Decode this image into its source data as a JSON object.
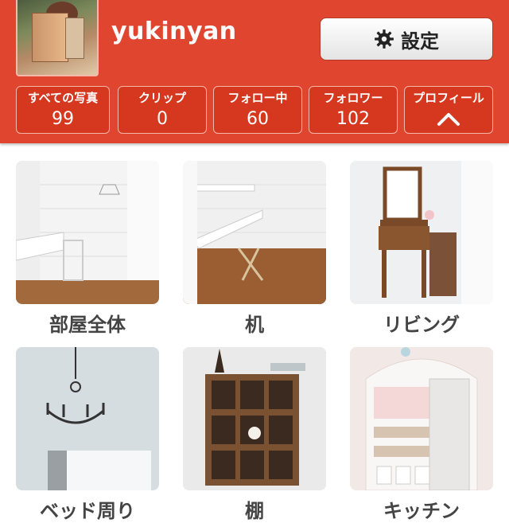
{
  "profile": {
    "username": "yukinyan",
    "avatar_icon": "profile-photo"
  },
  "settings": {
    "label": "設定",
    "icon": "gear-icon"
  },
  "stats": [
    {
      "label": "すべての写真",
      "value": "99"
    },
    {
      "label": "クリップ",
      "value": "0"
    },
    {
      "label": "フォロー中",
      "value": "60"
    },
    {
      "label": "フォロワー",
      "value": "102"
    },
    {
      "label": "プロフィール",
      "icon": "chevron-up-icon"
    }
  ],
  "categories": [
    {
      "label": "部屋全体"
    },
    {
      "label": "机"
    },
    {
      "label": "リビング"
    },
    {
      "label": "ベッド周り"
    },
    {
      "label": "棚"
    },
    {
      "label": "キッチン"
    }
  ],
  "colors": {
    "header": "#e0452f",
    "stat_button": "#d6381f",
    "caption": "#444444"
  }
}
